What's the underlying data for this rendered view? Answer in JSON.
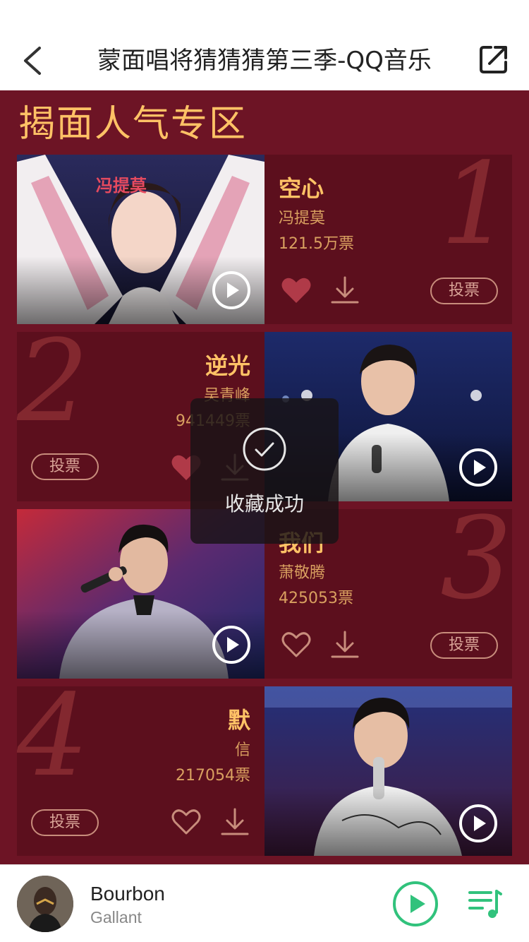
{
  "nav": {
    "title": "蒙面唱将猜猜猜第三季-QQ音乐",
    "back_icon": "chevron-left-icon",
    "share_icon": "share-external-icon"
  },
  "section": {
    "title": "揭面人气专区"
  },
  "cards": [
    {
      "rank": "1",
      "song": "空心",
      "artist": "冯提莫",
      "votes": "121.5万票",
      "vote_label": "投票",
      "liked": true
    },
    {
      "rank": "2",
      "song": "逆光",
      "artist": "吴青峰",
      "votes": "941449票",
      "vote_label": "投票",
      "liked": true
    },
    {
      "rank": "3",
      "song": "我们",
      "artist": "萧敬腾",
      "votes": "425053票",
      "vote_label": "投票",
      "liked": false
    },
    {
      "rank": "4",
      "song": "默",
      "artist": "信",
      "votes": "217054票",
      "vote_label": "投票",
      "liked": false
    }
  ],
  "toast": {
    "text": "收藏成功"
  },
  "player": {
    "song": "Bourbon",
    "artist": "Gallant"
  },
  "colors": {
    "background": "#6d1425",
    "card": "#5c0f1d",
    "accent": "#ffc266",
    "heart_liked": "#b03a48",
    "player_green": "#31c27c"
  }
}
